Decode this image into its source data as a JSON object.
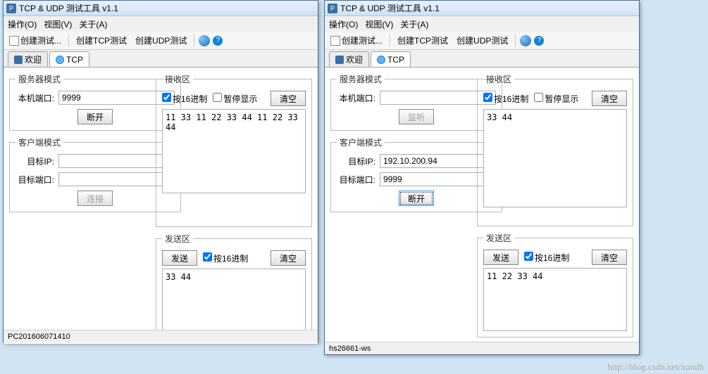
{
  "title": "TCP & UDP 测试工具 v1.1",
  "menus": {
    "ops": "操作(O)",
    "view": "视图(V)",
    "about": "关于(A)"
  },
  "toolbar": {
    "create_test": "创建测试...",
    "create_tcp": "创建TCP测试",
    "create_udp": "创建UDP测试"
  },
  "tabs": {
    "welcome": "欢迎",
    "tcp": "TCP"
  },
  "labels": {
    "server_mode": "服务器模式",
    "client_mode": "客户端模式",
    "local_port": "本机端口:",
    "target_ip": "目标IP:",
    "target_port": "目标端口:",
    "disconnect": "断开",
    "connect": "连接",
    "listen": "监听",
    "recv_area": "接收区",
    "send_area": "发送区",
    "hex16": "按16进制",
    "pause": "暂停显示",
    "clear": "清空",
    "send": "发送"
  },
  "win1": {
    "local_port": "9999",
    "target_ip": "",
    "target_port": "",
    "recv_data": "11 33 11 22 33 44 11 22 33 44",
    "send_data": "33 44",
    "status": "PC201606071410"
  },
  "win2": {
    "local_port": "",
    "target_ip": "192.10.200.94",
    "target_port": "9999",
    "recv_data": "33 44",
    "send_data": "11 22 33 44",
    "status": "hs26661-ws"
  },
  "watermark": "http://blog.csdn.net/xundh"
}
